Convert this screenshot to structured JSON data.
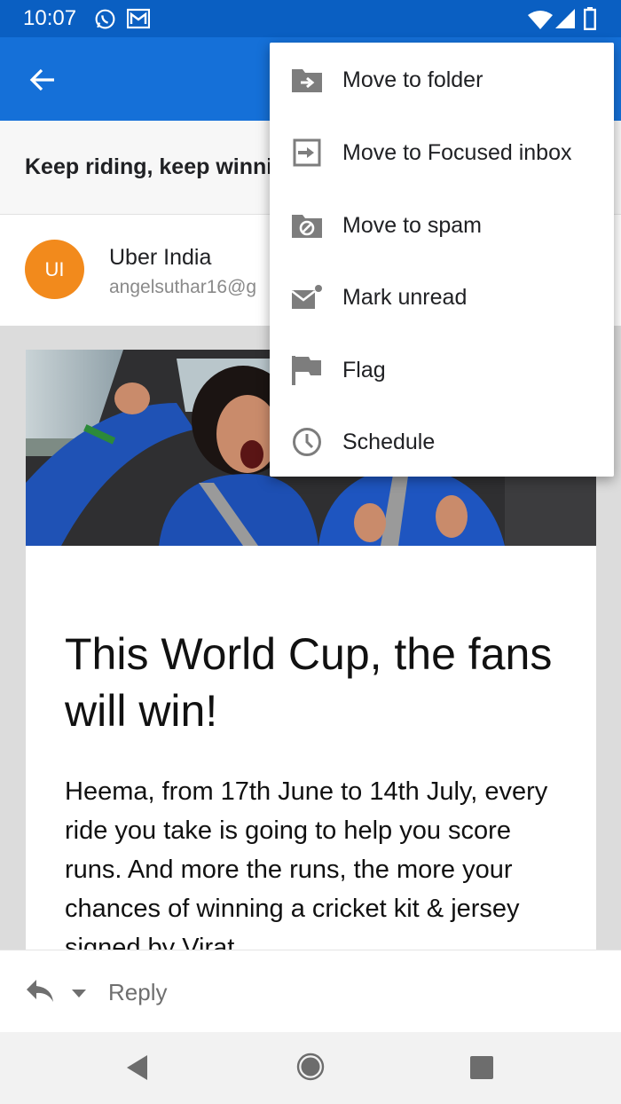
{
  "status_bar": {
    "time": "10:07"
  },
  "email": {
    "subject": "Keep riding, keep winni",
    "sender_name": "Uber India",
    "sender_email": "angelsuthar16@g",
    "avatar_initials": "UI",
    "avatar_color": "#f28a1c",
    "headline": "This World Cup, the fans will win!",
    "body_text": "Heema, from 17th June to 14th July, every ride you take is going to help you score runs. And more the runs, the more your chances of winning a cricket kit & jersey signed by Virat"
  },
  "reply_bar": {
    "label": "Reply"
  },
  "menu": {
    "items": [
      {
        "label": "Move to folder",
        "icon": "folder-move-icon"
      },
      {
        "label": "Move to Focused inbox",
        "icon": "focused-inbox-icon"
      },
      {
        "label": "Move to spam",
        "icon": "spam-folder-icon"
      },
      {
        "label": "Mark unread",
        "icon": "mark-unread-icon"
      },
      {
        "label": "Flag",
        "icon": "flag-icon"
      },
      {
        "label": "Schedule",
        "icon": "clock-icon"
      }
    ]
  },
  "colors": {
    "app_bar": "#1570d8",
    "status_bar": "#0a5fc2",
    "menu_icon": "#7d7d7d"
  }
}
